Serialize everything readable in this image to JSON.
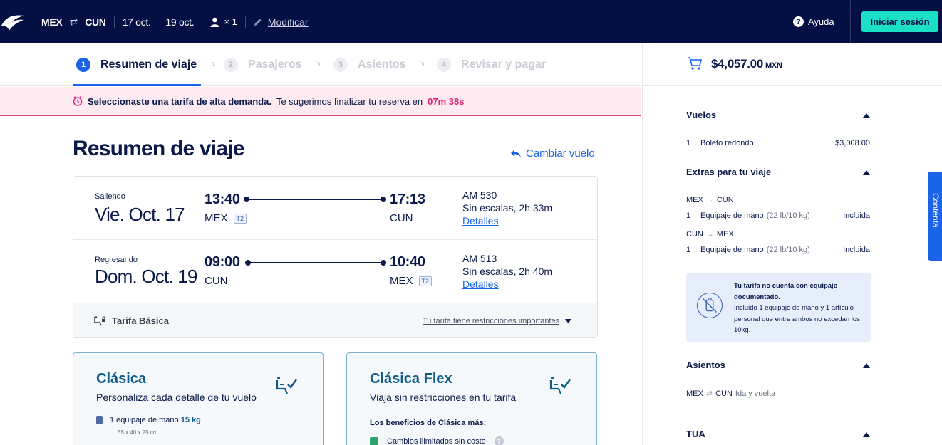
{
  "header": {
    "origin": "MEX",
    "destination": "CUN",
    "dates": "17 oct. — 19 oct.",
    "passengers": "× 1",
    "modify_label": "Modificar",
    "help_label": "Ayuda",
    "login_label": "Iniciar sesión"
  },
  "steps": [
    {
      "num": "1",
      "label": "Resumen de viaje",
      "active": true
    },
    {
      "num": "2",
      "label": "Pasajeros",
      "active": false
    },
    {
      "num": "3",
      "label": "Asientos",
      "active": false
    },
    {
      "num": "4",
      "label": "Revisar y pagar",
      "active": false
    }
  ],
  "alert": {
    "bold_text": "Seleccionaste una tarifa de alta demanda.",
    "text": "Te sugerimos finalizar tu reserva en",
    "time": "07m 38s"
  },
  "main": {
    "title": "Resumen de viaje",
    "change_flight_label": "Cambiar vuelo"
  },
  "flights": {
    "outbound": {
      "direction": "Saliendo",
      "date": "Vie. Oct. 17",
      "dep_time": "13:40",
      "dep_code": "MEX",
      "dep_terminal": "T2",
      "arr_time": "17:13",
      "arr_code": "CUN",
      "flight_no": "AM 530",
      "stops": "Sin escalas, 2h 33m",
      "details_label": "Detalles"
    },
    "return": {
      "direction": "Regresando",
      "date": "Dom. Oct. 19",
      "dep_time": "09:00",
      "dep_code": "CUN",
      "arr_time": "10:40",
      "arr_code": "MEX",
      "arr_terminal": "T2",
      "flight_no": "AM 513",
      "stops": "Sin escalas, 2h 40m",
      "details_label": "Detalles"
    },
    "fare_name": "Tarifa Básica",
    "restrictions_label": "Tu tarifa tiene restricciones importantes"
  },
  "upgrades": {
    "clasica": {
      "title": "Clásica",
      "subtitle": "Personaliza cada detalle de tu vuelo",
      "feature_prefix": "1 equipaje de mano",
      "feature_bold": "15 kg",
      "feature_sub": "55 x 40 x 25 cm"
    },
    "flex": {
      "title": "Clásica Flex",
      "subtitle": "Viaja sin restricciones en tu tarifa",
      "benefits_title": "Los beneficios de Clásica más:",
      "feature": "Cambios ilimitados sin costo"
    }
  },
  "summary": {
    "total": "$4,057.00",
    "currency": "MXN",
    "flights_title": "Vuelos",
    "ticket_qty": "1",
    "ticket_label": "Boleto redondo",
    "ticket_price": "$3,008.00",
    "extras_title": "Extras para tu viaje",
    "extra1_route_from": "MEX",
    "extra1_route_to": "CUN",
    "extra1_qty": "1",
    "extra1_label": "Equipaje de mano",
    "extra1_weight": "(22 lb/10 kg)",
    "extra1_status": "Incluida",
    "extra2_route_from": "CUN",
    "extra2_route_to": "MEX",
    "extra2_qty": "1",
    "extra2_label": "Equipaje de mano",
    "extra2_weight": "(22 lb/10 kg)",
    "extra2_status": "Incluida",
    "info_bold": "Tu tarifa no cuenta con equipaje documentado.",
    "info_text": "Incluido 1 equipaje de mano y 1 artículo personal que entre ambos no excedan los 10kg.",
    "seats_title": "Asientos",
    "seats_from": "MEX",
    "seats_to": "CUN",
    "seats_trip": "Ida y vuelta",
    "tua_title": "TUA"
  },
  "side_tab_label": "Contenta"
}
